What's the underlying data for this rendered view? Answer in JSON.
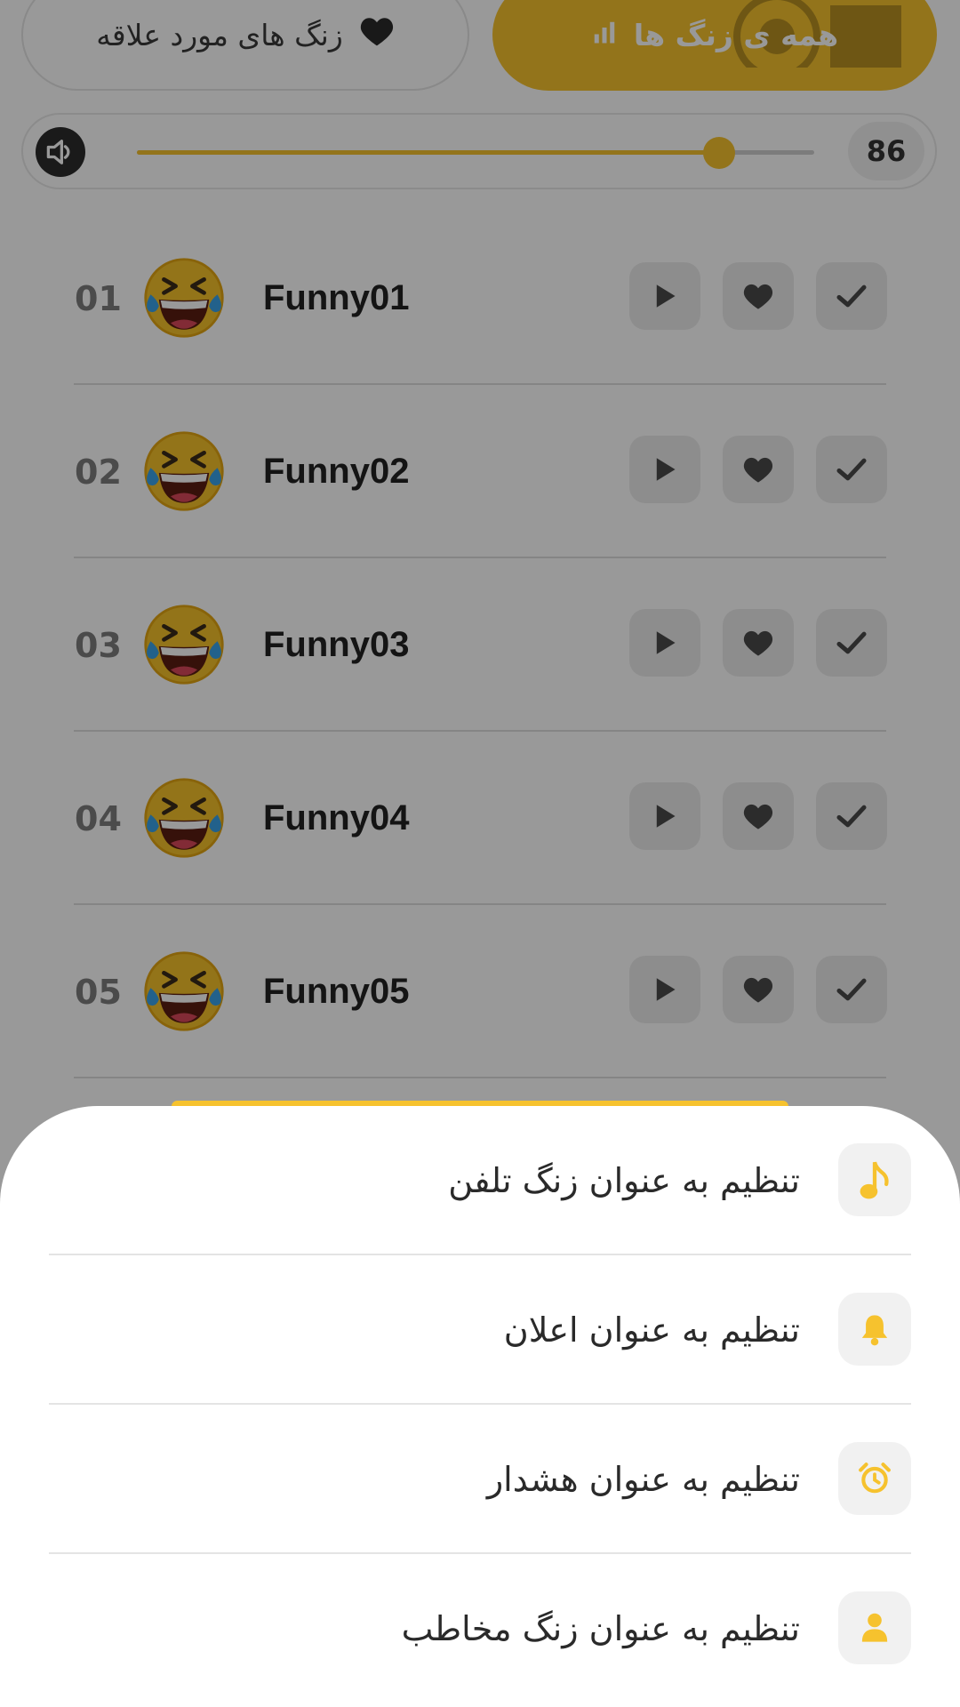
{
  "tabs": {
    "favorites_label": "زنگ های مورد علاقه",
    "all_label": "همه ی زنگ ها"
  },
  "volume": {
    "value": "86",
    "level": 0.86
  },
  "ringtones": [
    {
      "number": "01",
      "name": "Funny01"
    },
    {
      "number": "02",
      "name": "Funny02"
    },
    {
      "number": "03",
      "name": "Funny03"
    },
    {
      "number": "04",
      "name": "Funny04"
    },
    {
      "number": "05",
      "name": "Funny05"
    }
  ],
  "sheet": {
    "options": [
      {
        "label": "تنظیم به عنوان زنگ تلفن",
        "icon": "music-note-icon"
      },
      {
        "label": "تنظیم به عنوان اعلان",
        "icon": "bell-icon"
      },
      {
        "label": "تنظیم به عنوان هشدار",
        "icon": "alarm-clock-icon"
      },
      {
        "label": "تنظیم به عنوان زنگ مخاطب",
        "icon": "person-icon"
      }
    ]
  },
  "colors": {
    "accent": "#f6c22e",
    "dim_overlay": "rgba(0,0,0,0.4)",
    "button_bg": "#ececec"
  }
}
